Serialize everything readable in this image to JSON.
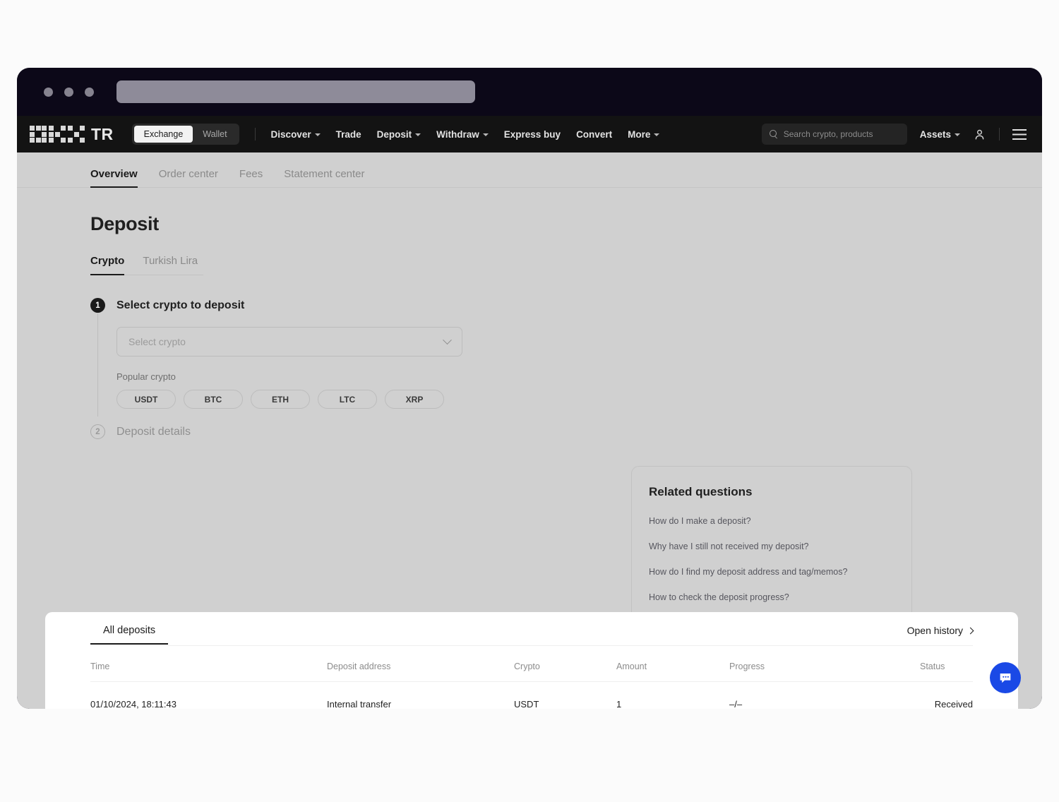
{
  "browser": {
    "address_bar_value": "",
    "traffic_lights": [
      "close",
      "minimize",
      "maximize"
    ]
  },
  "topnav": {
    "logo_text": "TR",
    "logo_icon": "okx-logo-icon",
    "segments": [
      {
        "label": "Exchange",
        "active": true
      },
      {
        "label": "Wallet",
        "active": false
      }
    ],
    "links": [
      {
        "label": "Discover",
        "caret": true
      },
      {
        "label": "Trade",
        "caret": false
      },
      {
        "label": "Deposit",
        "caret": true
      },
      {
        "label": "Withdraw",
        "caret": true
      },
      {
        "label": "Express buy",
        "caret": false
      },
      {
        "label": "Convert",
        "caret": false
      },
      {
        "label": "More",
        "caret": true
      }
    ],
    "search": {
      "placeholder": "Search crypto, products",
      "icon": "search-icon",
      "value": ""
    },
    "assets_label": "Assets",
    "profile_icon": "user-icon",
    "menu_icon": "hamburger-menu-icon"
  },
  "subnav": {
    "items": [
      {
        "label": "Overview",
        "active": true
      },
      {
        "label": "Order center",
        "active": false
      },
      {
        "label": "Fees",
        "active": false
      },
      {
        "label": "Statement center",
        "active": false
      }
    ]
  },
  "page": {
    "title": "Deposit",
    "type_tabs": [
      {
        "label": "Crypto",
        "active": true
      },
      {
        "label": "Turkish Lira",
        "active": false
      }
    ]
  },
  "steps": [
    {
      "number": "1",
      "title": "Select crypto to deposit",
      "active": true,
      "select": {
        "placeholder": "Select crypto",
        "value": "",
        "chevron_icon": "chevron-down-icon"
      },
      "popular_label": "Popular crypto",
      "chips": [
        "USDT",
        "BTC",
        "ETH",
        "LTC",
        "XRP"
      ]
    },
    {
      "number": "2",
      "title": "Deposit details",
      "active": false
    }
  ],
  "related": {
    "title": "Related questions",
    "items": [
      "How do I make a deposit?",
      "Why have I still not received my deposit?",
      "How do I find my deposit address and tag/memos?",
      "How to check the deposit progress?"
    ]
  },
  "deposits": {
    "tab_label": "All deposits",
    "open_history_label": "Open history",
    "open_history_icon": "chevron-right-icon",
    "columns": [
      "Time",
      "Deposit address",
      "Crypto",
      "Amount",
      "Progress",
      "Status"
    ],
    "rows": [
      {
        "time": "01/10/2024, 18:11:43",
        "address": "Internal transfer",
        "crypto": "USDT",
        "amount": "1",
        "progress": "–/–",
        "status": "Received"
      }
    ]
  },
  "chat": {
    "icon": "chat-bubble-icon",
    "color": "#1a49e6"
  },
  "colors": {
    "page_background": "#d0d0d0",
    "nav_background": "#131313",
    "card_background": "#ffffff",
    "frame": "#14101f",
    "accent": "#1a49e6"
  }
}
